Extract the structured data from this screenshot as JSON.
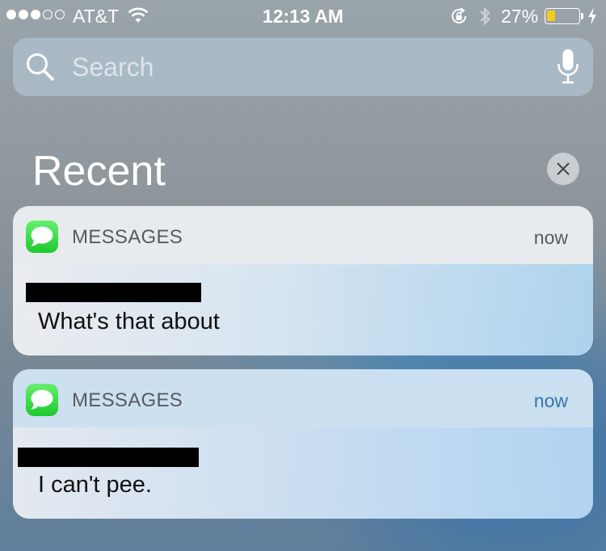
{
  "status_bar": {
    "signal_bars_filled": 3,
    "signal_bars_total": 5,
    "carrier": "AT&T",
    "wifi_icon": "wifi-icon",
    "time": "12:13 AM",
    "rotation_lock_icon": "rotation-lock-icon",
    "bluetooth_icon": "bluetooth-icon",
    "battery_percent": "27%",
    "battery_level": 0.27,
    "battery_color": "#f4cc1d",
    "charging_icon": "charging-bolt-icon"
  },
  "search": {
    "placeholder": "Search",
    "search_icon": "search-icon",
    "mic_icon": "microphone-icon"
  },
  "recent": {
    "title": "Recent",
    "clear_icon": "close-icon"
  },
  "notifications": [
    {
      "app_name": "MESSAGES",
      "app_icon": "messages-icon",
      "time": "now",
      "sender_redacted": true,
      "message": "What's that about"
    },
    {
      "app_name": "MESSAGES",
      "app_icon": "messages-icon",
      "time": "now",
      "sender_redacted": true,
      "message": "I can't pee."
    }
  ],
  "colors": {
    "messages_green": "#1ec92d",
    "time_link_blue": "#3a74a8"
  }
}
